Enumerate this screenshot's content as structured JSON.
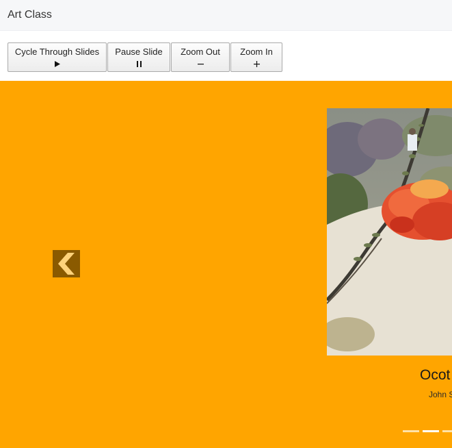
{
  "app": {
    "title": "Art Class"
  },
  "toolbar": {
    "cycle_label": "Cycle Through Slides",
    "cycle_icon": "play-icon",
    "pause_label": "Pause Slide",
    "pause_icon": "pause-icon",
    "zoom_out_label": "Zoom Out",
    "zoom_out_icon": "minus-icon",
    "zoom_in_label": "Zoom In",
    "zoom_in_icon": "plus-icon"
  },
  "carousel": {
    "background": "#ffa500",
    "prev_icon": "chevron-left-icon",
    "slide": {
      "title": "Ocot",
      "author": "John S",
      "image_subject": "ocotillo flower"
    },
    "indicator_count": 3,
    "active_indicator": 2
  }
}
